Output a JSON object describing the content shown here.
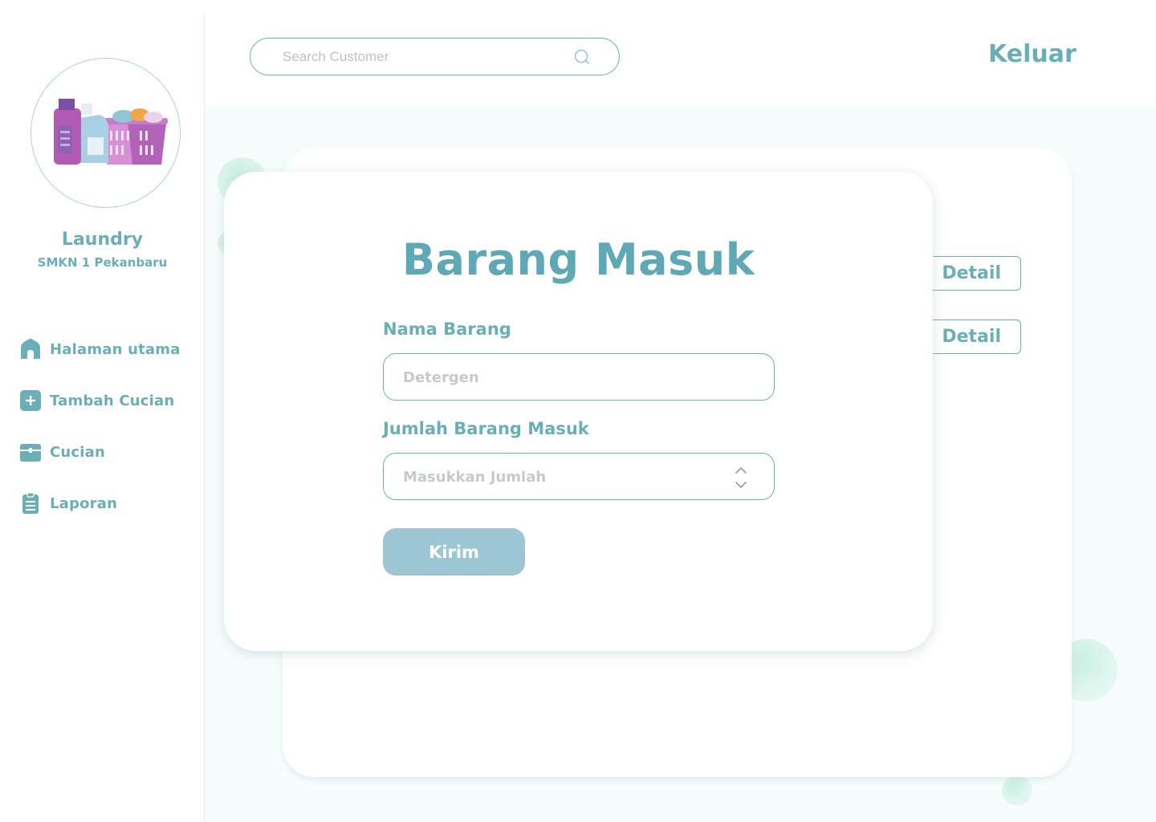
{
  "sidebar": {
    "brand_name": "Laundry",
    "brand_sub": "SMKN 1 Pekanbaru",
    "items": [
      {
        "label": "Halaman utama",
        "icon": "home-icon"
      },
      {
        "label": "Tambah Cucian",
        "icon": "plus-square-icon"
      },
      {
        "label": "Cucian",
        "icon": "box-icon"
      },
      {
        "label": "Laporan",
        "icon": "clipboard-icon"
      }
    ]
  },
  "header": {
    "search_placeholder": "Search Customer",
    "logout_label": "Keluar"
  },
  "background": {
    "detail_buttons": [
      "Detail",
      "Detail"
    ]
  },
  "modal": {
    "title": "Barang Masuk",
    "name_label": "Nama Barang",
    "name_placeholder": "Detergen",
    "qty_label": "Jumlah Barang Masuk",
    "qty_placeholder": "Masukkan Jumlah",
    "submit_label": "Kirim"
  },
  "colors": {
    "accent": "#6aafb7",
    "title": "#5fa8b5",
    "button": "#9cc6d4",
    "content_bg": "#f7fdfd"
  }
}
